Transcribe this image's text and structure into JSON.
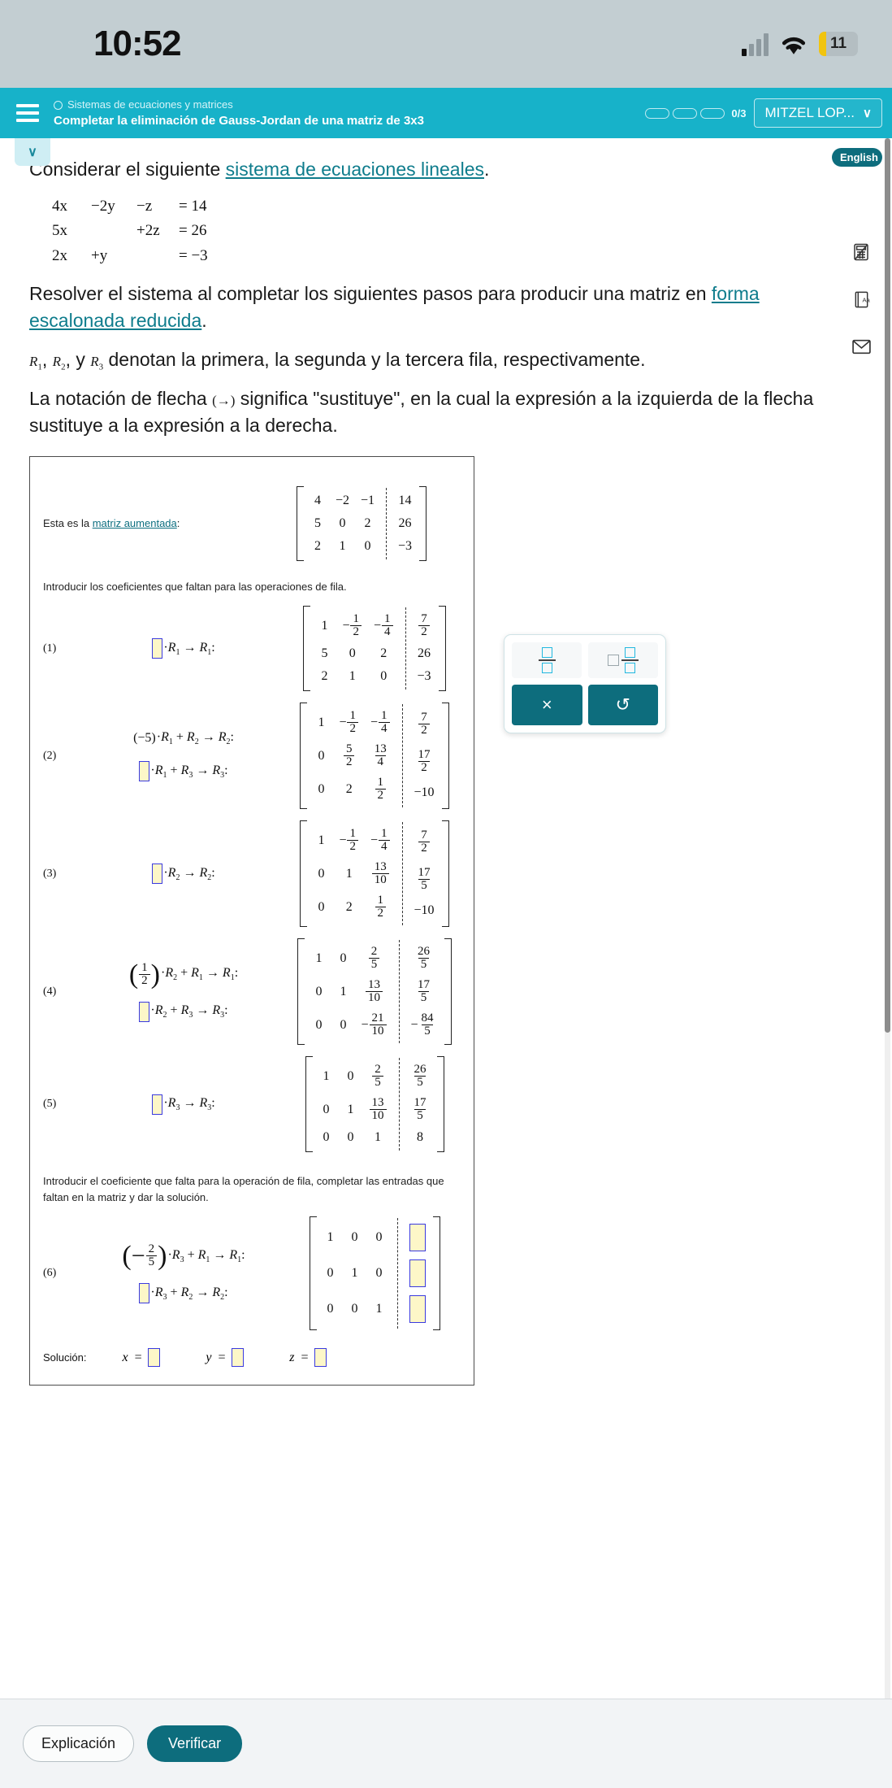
{
  "status_bar": {
    "time": "10:52",
    "battery_level": "11",
    "wifi_icon": "wifi-icon",
    "signal_icon": "cellular-signal-icon"
  },
  "header": {
    "menu_icon": "hamburger-menu-icon",
    "breadcrumb": "Sistemas de ecuaciones y matrices",
    "title": "Completar la eliminación de Gauss-Jordan de una matriz de 3x3",
    "progress_text": "0/3",
    "progress_segments": 3,
    "user_label": "MITZEL LOP...",
    "chevron": "∨",
    "accent_color": "#17b2c9"
  },
  "right_rail": {
    "english_badge": "English",
    "icons": [
      "calculator-icon",
      "dictionary-icon",
      "mail-icon"
    ]
  },
  "problem": {
    "intro_before": "Considerar el siguiente ",
    "intro_link": "sistema de ecuaciones lineales",
    "intro_after": ".",
    "equations": [
      {
        "t1": "4x",
        "t2": "−2y",
        "t3": "−z",
        "t4": "= 14"
      },
      {
        "t1": "5x",
        "t2": "",
        "t3": "+2z",
        "t4": "= 26"
      },
      {
        "t1": "2x",
        "t2": "+y",
        "t3": "",
        "t4": "= −3"
      }
    ],
    "para1_before": "Resolver el sistema al completar los siguientes pasos para producir una matriz en ",
    "para1_link": "forma escalonada reducida",
    "para1_after": ".",
    "para2_after": " denotan la primera, la segunda y la tercera fila, respectivamente.",
    "para3_before": "La notación de flecha ",
    "para3_arrow": "(→)",
    "para3_after": " significa \"sustituye\", en la cual la expresión a la izquierda de la flecha sustituye a la expresión a la derecha."
  },
  "work": {
    "aug_label_before": "Esta es la ",
    "aug_label_link": "matriz aumentada",
    "aug_label_after": ":",
    "aug_matrix": [
      [
        "4",
        "−2",
        "−1",
        "14"
      ],
      [
        "5",
        "0",
        "2",
        "26"
      ],
      [
        "2",
        "1",
        "0",
        "−3"
      ]
    ],
    "instruction_1": "Introducir los coeficientes que faltan para las operaciones de fila.",
    "instruction_2": "Introducir el coeficiente que falta para la operación de fila, completar las entradas que faltan en la matriz y dar la solución.",
    "steps": [
      {
        "num": "(1)",
        "ops": [
          {
            "coef_type": "input",
            "coef": "",
            "rest_rows": "R₁",
            "target": "R₁",
            "has_plus": false
          }
        ],
        "matrix": [
          [
            "1",
            "-1/2",
            "-1/4",
            "7/2"
          ],
          [
            "5",
            "0",
            "2",
            "26"
          ],
          [
            "2",
            "1",
            "0",
            "−3"
          ]
        ]
      },
      {
        "num": "(2)",
        "ops": [
          {
            "coef_type": "text",
            "coef": "(−5)",
            "rest_rows": "R₁ + R₂",
            "target": "R₂",
            "has_plus": true
          },
          {
            "coef_type": "input",
            "coef": "",
            "rest_rows": "R₁ + R₃",
            "target": "R₃",
            "has_plus": true
          }
        ],
        "matrix": [
          [
            "1",
            "-1/2",
            "-1/4",
            "7/2"
          ],
          [
            "0",
            "5/2",
            "13/4",
            "17/2"
          ],
          [
            "0",
            "2",
            "1/2",
            "−10"
          ]
        ]
      },
      {
        "num": "(3)",
        "ops": [
          {
            "coef_type": "input",
            "coef": "",
            "rest_rows": "R₂",
            "target": "R₂",
            "has_plus": false
          }
        ],
        "matrix": [
          [
            "1",
            "-1/2",
            "-1/4",
            "7/2"
          ],
          [
            "0",
            "1",
            "13/10",
            "17/5"
          ],
          [
            "0",
            "2",
            "1/2",
            "−10"
          ]
        ]
      },
      {
        "num": "(4)",
        "ops": [
          {
            "coef_type": "frac",
            "coef": "1/2",
            "rest_rows": "R₂ + R₁",
            "target": "R₁",
            "has_plus": true
          },
          {
            "coef_type": "input",
            "coef": "",
            "rest_rows": "R₂ + R₃",
            "target": "R₃",
            "has_plus": true
          }
        ],
        "matrix": [
          [
            "1",
            "0",
            "2/5",
            "26/5"
          ],
          [
            "0",
            "1",
            "13/10",
            "17/5"
          ],
          [
            "0",
            "0",
            "-21/10",
            "-84/5"
          ]
        ]
      },
      {
        "num": "(5)",
        "ops": [
          {
            "coef_type": "input",
            "coef": "",
            "rest_rows": "R₃",
            "target": "R₃",
            "has_plus": false
          }
        ],
        "matrix": [
          [
            "1",
            "0",
            "2/5",
            "26/5"
          ],
          [
            "0",
            "1",
            "13/10",
            "17/5"
          ],
          [
            "0",
            "0",
            "1",
            "8"
          ]
        ]
      },
      {
        "num": "(6)",
        "ops": [
          {
            "coef_type": "negfrac",
            "coef": "-2/5",
            "rest_rows": "R₃ + R₁",
            "target": "R₁",
            "has_plus": true
          },
          {
            "coef_type": "input",
            "coef": "",
            "rest_rows": "R₃ + R₂",
            "target": "R₂",
            "has_plus": true
          }
        ],
        "matrix": [
          [
            "1",
            "0",
            "0",
            "INPUT"
          ],
          [
            "0",
            "1",
            "0",
            "INPUT"
          ],
          [
            "0",
            "0",
            "1",
            "INPUT"
          ]
        ]
      }
    ],
    "solution_label": "Solución:",
    "solution_vars": [
      {
        "name": "x",
        "eq": "=",
        "value": ""
      },
      {
        "name": "y",
        "eq": "=",
        "value": ""
      },
      {
        "name": "z",
        "eq": "=",
        "value": ""
      }
    ]
  },
  "math_toolbar": {
    "fraction_button": "fraction-template-icon",
    "mixed_number_button": "mixed-number-template-icon",
    "clear_label": "×",
    "undo_label": "↺"
  },
  "footer": {
    "explanation_label": "Explicación",
    "verify_label": "Verificar",
    "verify_color": "#0d6d7d"
  }
}
